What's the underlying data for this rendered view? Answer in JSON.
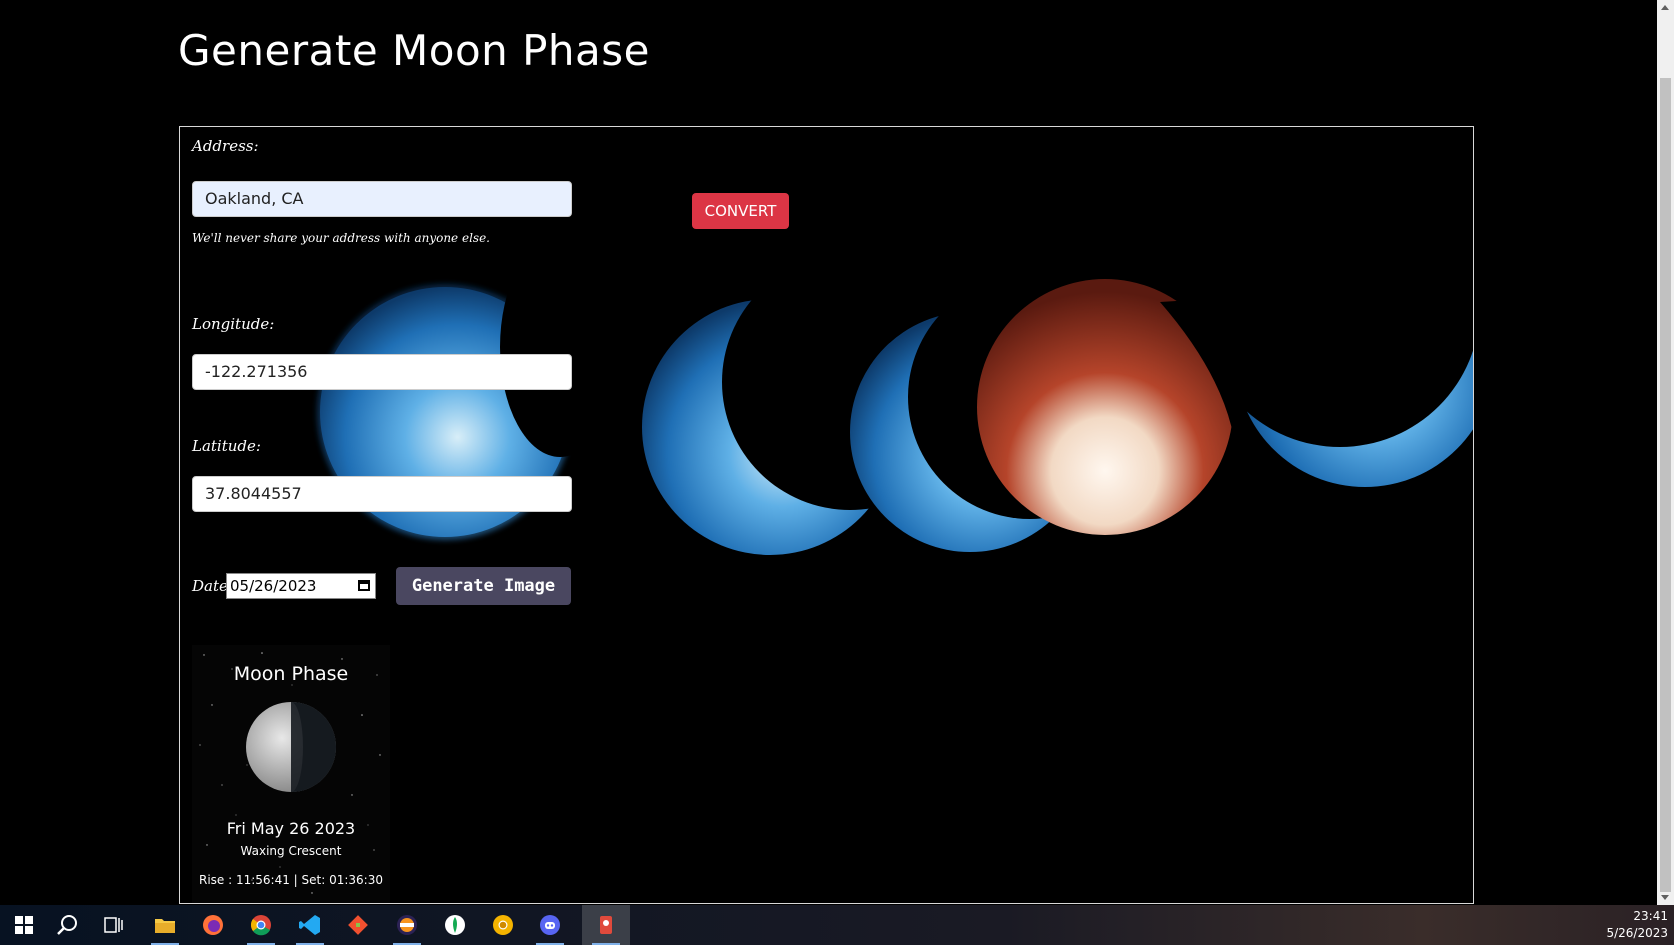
{
  "page": {
    "title": "Generate Moon Phase"
  },
  "form": {
    "address_label": "Address:",
    "address_value": "Oakland, CA",
    "address_help": "We'll never share your address with anyone else.",
    "convert_label": "CONVERT",
    "longitude_label": "Longitude:",
    "longitude_value": "-122.271356",
    "latitude_label": "Latitude:",
    "latitude_value": "37.8044557",
    "date_label": "Date:",
    "date_value": "05/26/2023",
    "generate_label": "Generate Image"
  },
  "moon_card": {
    "title": "Moon Phase",
    "date": "Fri May 26 2023",
    "phase": "Waxing Crescent",
    "times": "Rise : 11:56:41 | Set: 01:36:30"
  },
  "colors": {
    "convert_button": "#dc3545",
    "generate_button": "#4a4760",
    "moon_blue": "#3f8fd1",
    "moon_red": "#b5442a"
  },
  "taskbar": {
    "icons": [
      "windows-start-icon",
      "search-icon",
      "task-view-icon",
      "file-explorer-icon",
      "firefox-icon",
      "chrome-icon",
      "vscode-icon",
      "git-icon",
      "eclipse-icon",
      "mongodb-compass-icon",
      "chrome-canary-icon",
      "discord-icon",
      "snipping-tool-icon"
    ],
    "time": "23:41",
    "date": "5/26/2023"
  }
}
